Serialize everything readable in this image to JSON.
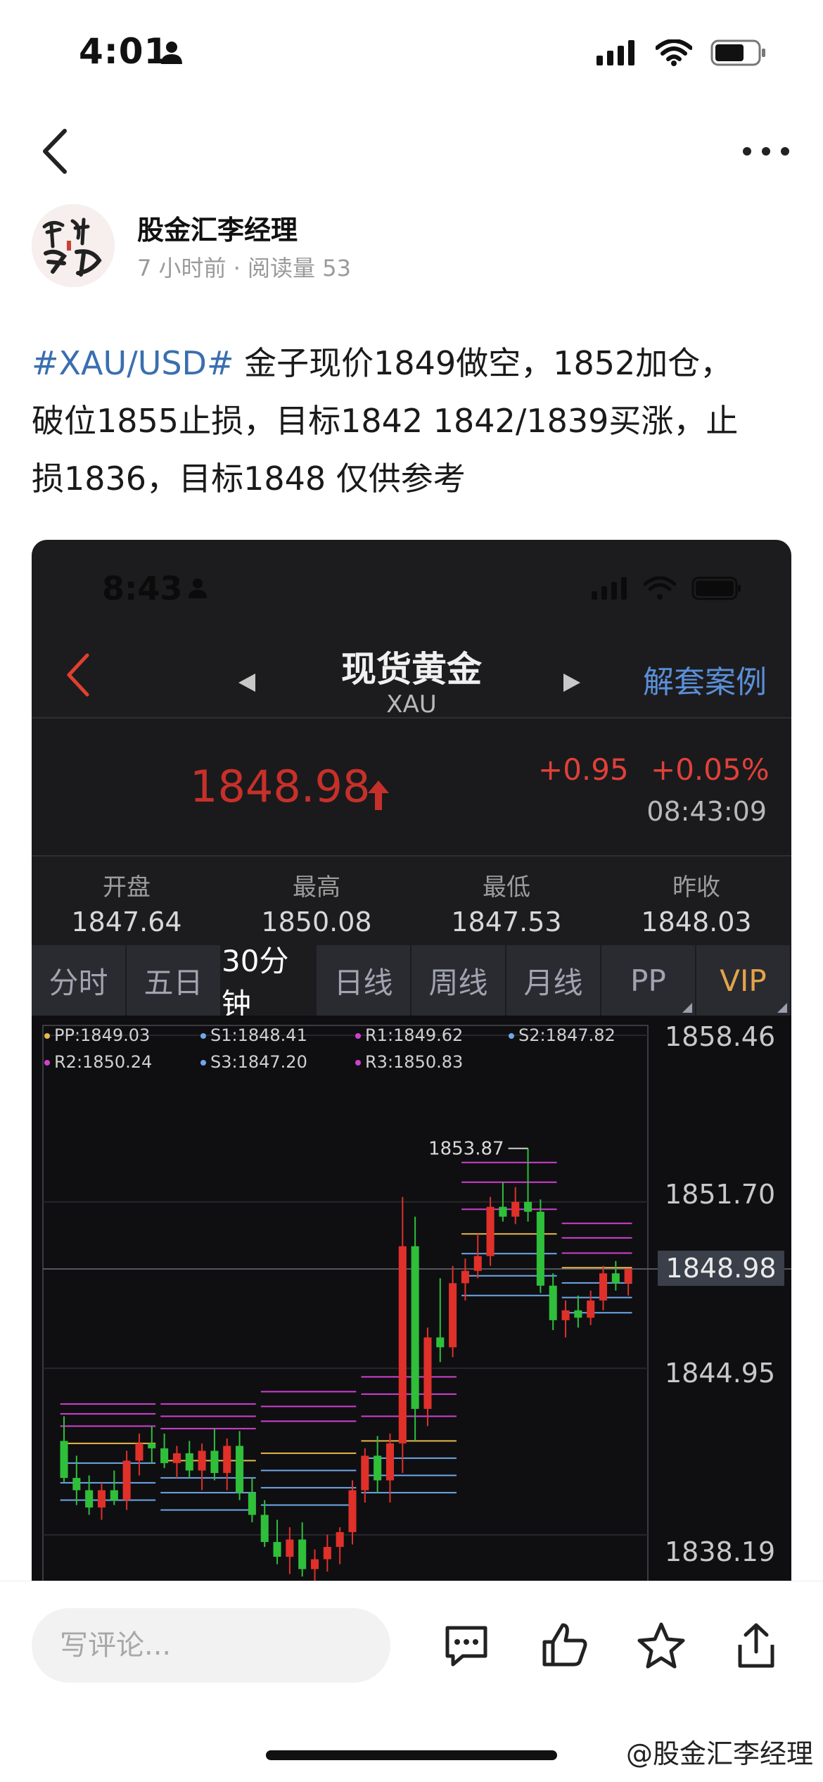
{
  "status_bar": {
    "time": "4:01"
  },
  "author": {
    "name": "股金汇李经理",
    "meta": "7 小时前 · 阅读量 53"
  },
  "post": {
    "hashtag": "#XAU/USD#",
    "line1_rest": " 金子现价1849做空，1852加仓，",
    "line2": "破位1855止损，目标1842 1842/1839买涨，止",
    "line3": "损1836，目标1848 仅供参考"
  },
  "embed": {
    "status_time": "8:43",
    "title": "现货黄金",
    "subtitle": "XAU",
    "link": "解套案例",
    "price": "1848.98",
    "change": "+0.95",
    "change_pct": "+0.05%",
    "update_time": "08:43:09",
    "ohlc": [
      {
        "label": "开盘",
        "value": "1847.64"
      },
      {
        "label": "最高",
        "value": "1850.08"
      },
      {
        "label": "最低",
        "value": "1847.53"
      },
      {
        "label": "昨收",
        "value": "1848.03"
      }
    ],
    "tabs": [
      "分时",
      "五日",
      "30分钟",
      "日线",
      "周线",
      "月线",
      "PP",
      "VIP"
    ],
    "active_tab": "30分钟",
    "legend": [
      {
        "text": "PP:1849.03",
        "color": "#e8b84a"
      },
      {
        "text": "S1:1848.41",
        "color": "#6fa8e8"
      },
      {
        "text": "R1:1849.62",
        "color": "#d040d0"
      },
      {
        "text": "S2:1847.82",
        "color": "#6fa8e8"
      },
      {
        "text": "R2:1850.24",
        "color": "#d040d0"
      },
      {
        "text": "S3:1847.20",
        "color": "#6fa8e8"
      },
      {
        "text": "R3:1850.83",
        "color": "#d040d0"
      }
    ],
    "y_labels": [
      "1858.46",
      "1851.70",
      "1844.95",
      "1838.19"
    ],
    "current_label": "1848.98",
    "peak_label": "1853.87",
    "colors": {
      "up": "#e0302a",
      "down": "#2fbf3a",
      "r": "#d040d0",
      "s": "#6fa8e8",
      "pp": "#e8b84a"
    }
  },
  "chart_data": {
    "type": "candlestick",
    "title": "",
    "ylim": [
      1836.3,
      1858.46
    ],
    "y_ticks": [
      1858.46,
      1851.7,
      1844.95,
      1838.19
    ],
    "current": 1848.98,
    "annotations": [
      {
        "text": "1853.87",
        "value": 1853.87
      }
    ],
    "candles": [
      {
        "o": 1842.0,
        "h": 1843.0,
        "l": 1840.3,
        "c": 1840.5
      },
      {
        "o": 1840.5,
        "h": 1841.4,
        "l": 1839.4,
        "c": 1840.0
      },
      {
        "o": 1840.0,
        "h": 1840.6,
        "l": 1839.0,
        "c": 1839.3
      },
      {
        "o": 1839.3,
        "h": 1840.3,
        "l": 1838.8,
        "c": 1840.0
      },
      {
        "o": 1840.0,
        "h": 1840.8,
        "l": 1839.4,
        "c": 1839.6
      },
      {
        "o": 1839.6,
        "h": 1841.6,
        "l": 1839.2,
        "c": 1841.2
      },
      {
        "o": 1841.2,
        "h": 1842.3,
        "l": 1840.6,
        "c": 1841.9
      },
      {
        "o": 1841.9,
        "h": 1842.6,
        "l": 1841.1,
        "c": 1841.7
      },
      {
        "o": 1841.7,
        "h": 1842.3,
        "l": 1840.9,
        "c": 1841.1
      },
      {
        "o": 1841.1,
        "h": 1841.8,
        "l": 1840.5,
        "c": 1841.5
      },
      {
        "o": 1841.5,
        "h": 1842.0,
        "l": 1840.5,
        "c": 1840.8
      },
      {
        "o": 1840.8,
        "h": 1841.9,
        "l": 1840.0,
        "c": 1841.6
      },
      {
        "o": 1841.6,
        "h": 1842.5,
        "l": 1840.4,
        "c": 1840.7
      },
      {
        "o": 1840.7,
        "h": 1842.1,
        "l": 1840.0,
        "c": 1841.8
      },
      {
        "o": 1841.8,
        "h": 1842.4,
        "l": 1839.6,
        "c": 1839.9
      },
      {
        "o": 1839.9,
        "h": 1840.5,
        "l": 1838.7,
        "c": 1839.0
      },
      {
        "o": 1839.0,
        "h": 1839.6,
        "l": 1837.7,
        "c": 1837.9
      },
      {
        "o": 1837.9,
        "h": 1838.8,
        "l": 1837.0,
        "c": 1837.3
      },
      {
        "o": 1837.3,
        "h": 1838.5,
        "l": 1836.6,
        "c": 1838.0
      },
      {
        "o": 1838.0,
        "h": 1838.7,
        "l": 1836.5,
        "c": 1836.8
      },
      {
        "o": 1836.8,
        "h": 1837.6,
        "l": 1836.3,
        "c": 1837.2
      },
      {
        "o": 1837.2,
        "h": 1838.2,
        "l": 1836.7,
        "c": 1837.7
      },
      {
        "o": 1837.7,
        "h": 1838.5,
        "l": 1837.0,
        "c": 1838.3
      },
      {
        "o": 1838.3,
        "h": 1840.4,
        "l": 1837.8,
        "c": 1840.0
      },
      {
        "o": 1840.0,
        "h": 1841.7,
        "l": 1839.5,
        "c": 1841.4
      },
      {
        "o": 1841.4,
        "h": 1842.2,
        "l": 1839.9,
        "c": 1840.4
      },
      {
        "o": 1840.4,
        "h": 1842.3,
        "l": 1839.5,
        "c": 1841.9
      },
      {
        "o": 1841.9,
        "h": 1851.9,
        "l": 1840.7,
        "c": 1849.9
      },
      {
        "o": 1849.9,
        "h": 1851.1,
        "l": 1842.0,
        "c": 1843.3
      },
      {
        "o": 1843.3,
        "h": 1846.6,
        "l": 1842.6,
        "c": 1846.2
      },
      {
        "o": 1846.2,
        "h": 1848.6,
        "l": 1845.2,
        "c": 1845.8
      },
      {
        "o": 1845.8,
        "h": 1849.1,
        "l": 1845.4,
        "c": 1848.4
      },
      {
        "o": 1848.4,
        "h": 1849.4,
        "l": 1847.7,
        "c": 1848.9
      },
      {
        "o": 1848.9,
        "h": 1850.4,
        "l": 1848.6,
        "c": 1849.5
      },
      {
        "o": 1849.5,
        "h": 1851.9,
        "l": 1849.1,
        "c": 1851.5
      },
      {
        "o": 1851.5,
        "h": 1852.5,
        "l": 1850.9,
        "c": 1851.1
      },
      {
        "o": 1851.1,
        "h": 1852.3,
        "l": 1850.8,
        "c": 1851.7
      },
      {
        "o": 1851.7,
        "h": 1853.87,
        "l": 1850.9,
        "c": 1851.3
      },
      {
        "o": 1851.3,
        "h": 1851.8,
        "l": 1848.0,
        "c": 1848.3
      },
      {
        "o": 1848.3,
        "h": 1848.8,
        "l": 1846.5,
        "c": 1846.9
      },
      {
        "o": 1846.9,
        "h": 1847.7,
        "l": 1846.2,
        "c": 1847.3
      },
      {
        "o": 1847.3,
        "h": 1847.9,
        "l": 1846.6,
        "c": 1847.0
      },
      {
        "o": 1847.0,
        "h": 1848.1,
        "l": 1846.7,
        "c": 1847.7
      },
      {
        "o": 1847.7,
        "h": 1849.1,
        "l": 1847.3,
        "c": 1848.8
      },
      {
        "o": 1848.8,
        "h": 1849.3,
        "l": 1848.1,
        "c": 1848.4
      },
      {
        "o": 1848.4,
        "h": 1848.9,
        "l": 1847.9,
        "c": 1848.98
      }
    ],
    "pivot_groups": [
      {
        "from": 0,
        "to": 7,
        "r": [
          1842.6,
          1843.1,
          1843.5
        ],
        "pp": 1841.9,
        "s": [
          1841.1,
          1840.3,
          1839.6
        ]
      },
      {
        "from": 8,
        "to": 15,
        "r": [
          1842.5,
          1843.0,
          1843.5
        ],
        "pp": 1841.2,
        "s": [
          1840.5,
          1839.9,
          1839.2
        ]
      },
      {
        "from": 16,
        "to": 23,
        "r": [
          1842.8,
          1843.4,
          1844.0
        ],
        "pp": 1841.5,
        "s": [
          1840.8,
          1840.1,
          1839.4
        ]
      },
      {
        "from": 24,
        "to": 31,
        "r": [
          1843.0,
          1843.9,
          1844.6
        ],
        "pp": 1842.0,
        "s": [
          1841.3,
          1840.6,
          1839.9
        ]
      },
      {
        "from": 32,
        "to": 39,
        "r": [
          1851.4,
          1852.5,
          1853.3
        ],
        "pp": 1850.4,
        "s": [
          1849.6,
          1848.7,
          1847.9
        ]
      },
      {
        "from": 40,
        "to": 45,
        "r": [
          1849.62,
          1850.24,
          1850.83
        ],
        "pp": 1849.03,
        "s": [
          1848.41,
          1847.82,
          1847.2
        ]
      }
    ]
  }
}
